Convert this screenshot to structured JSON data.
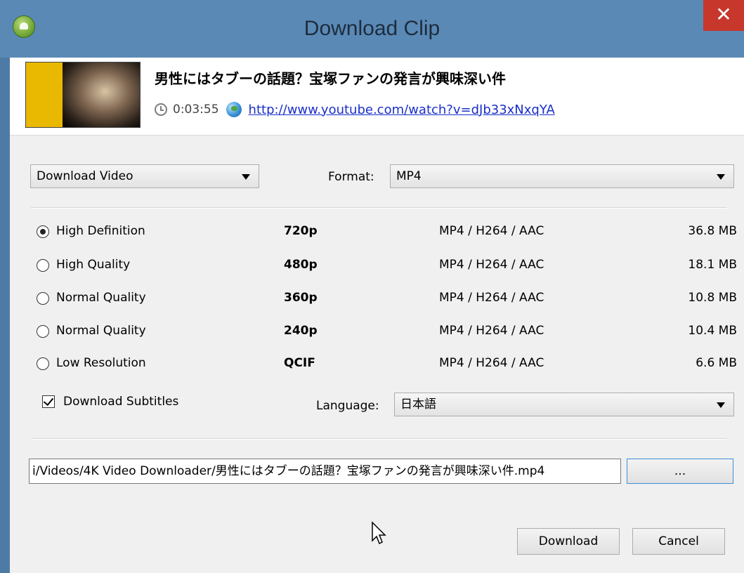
{
  "window": {
    "title": "Download Clip",
    "close_glyph": "✕"
  },
  "clip": {
    "title": "男性にはタブーの話題？宝塚ファンの発言が興味深い件",
    "duration": "0:03:55",
    "url": "http://www.youtube.com/watch?v=dJb33xNxqYA",
    "thumbnail_icon": "video-thumbnail"
  },
  "download_type": {
    "selected": "Download Video"
  },
  "format": {
    "label": "Format:",
    "selected": "MP4"
  },
  "quality_options": [
    {
      "name": "High Definition",
      "resolution": "720p",
      "codec": "MP4 / H264 / AAC",
      "size": "36.8 MB",
      "selected": true
    },
    {
      "name": "High Quality",
      "resolution": "480p",
      "codec": "MP4 / H264 / AAC",
      "size": "18.1 MB",
      "selected": false
    },
    {
      "name": "Normal Quality",
      "resolution": "360p",
      "codec": "MP4 / H264 / AAC",
      "size": "10.8 MB",
      "selected": false
    },
    {
      "name": "Normal Quality",
      "resolution": "240p",
      "codec": "MP4 / H264 / AAC",
      "size": "10.4 MB",
      "selected": false
    },
    {
      "name": "Low Resolution",
      "resolution": "QCIF",
      "codec": "MP4 / H264 / AAC",
      "size": "6.6 MB",
      "selected": false
    }
  ],
  "subtitles": {
    "label": "Download Subtitles",
    "checked": true
  },
  "language": {
    "label": "Language:",
    "selected": "日本語"
  },
  "save_path": {
    "value": "i/Videos/4K Video Downloader/男性にはタブーの話題？宝塚ファンの発言が興味深い件.mp4"
  },
  "buttons": {
    "browse": "...",
    "download": "Download",
    "cancel": "Cancel"
  }
}
